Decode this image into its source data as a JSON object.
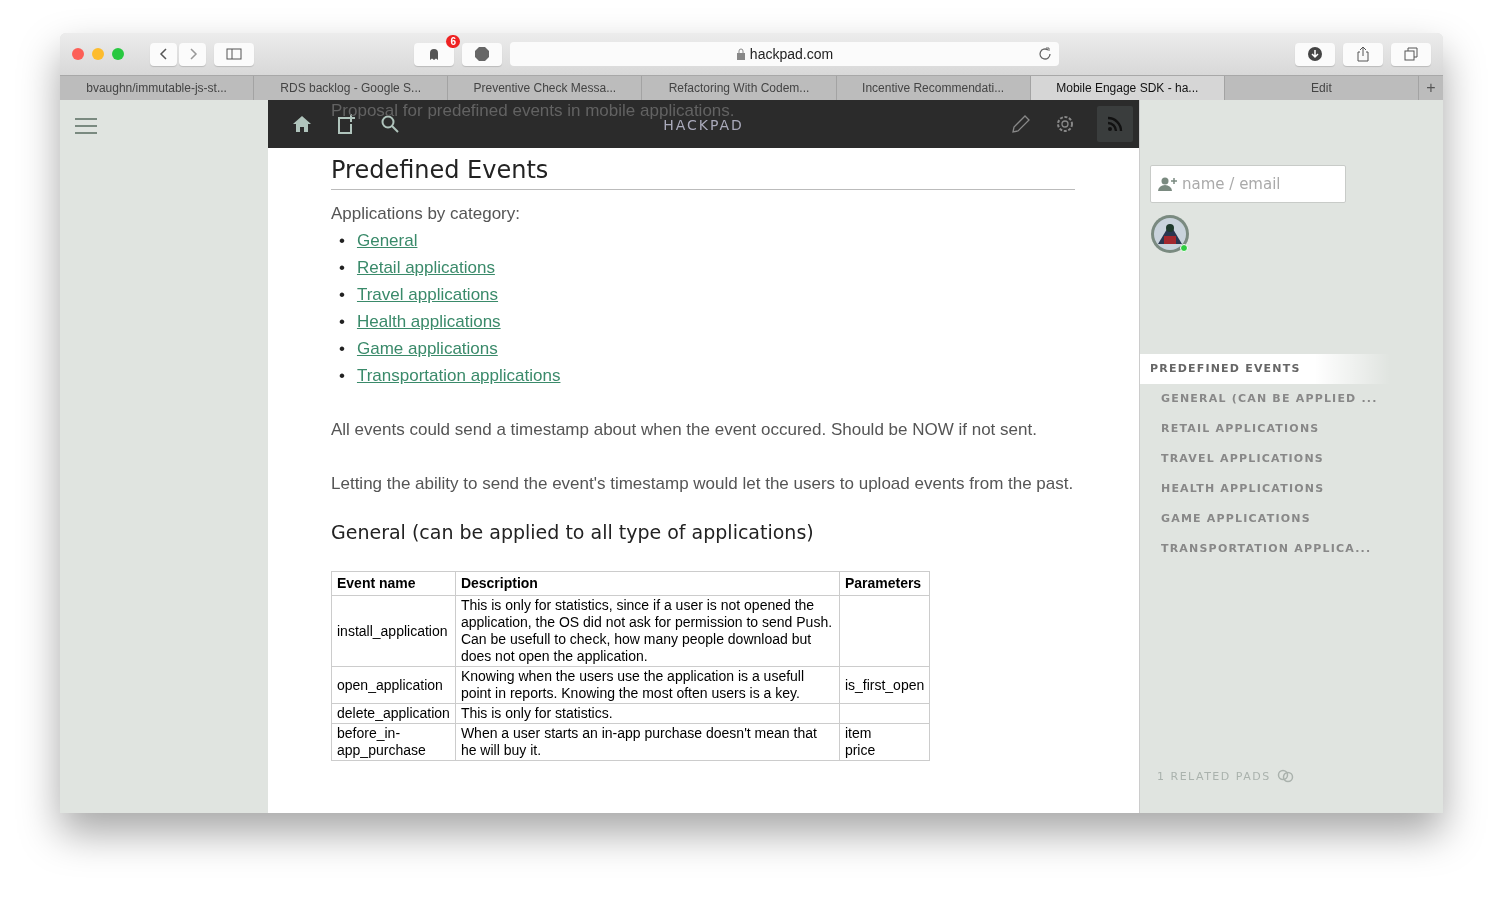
{
  "browser": {
    "address": "hackpad.com",
    "badge": "6",
    "tabs": [
      {
        "label": "bvaughn/immutable-js-st...",
        "selected": false
      },
      {
        "label": "RDS backlog - Google S...",
        "selected": false
      },
      {
        "label": "Preventive Check Messa...",
        "selected": false
      },
      {
        "label": "Refactoring With Codem...",
        "selected": false
      },
      {
        "label": "Incentive Recommendati...",
        "selected": false
      },
      {
        "label": "Mobile Engage SDK - ha...",
        "selected": true
      },
      {
        "label": "Edit",
        "selected": false
      }
    ],
    "new_tab": "+"
  },
  "header": {
    "brand": "HACKPAD",
    "ghost_title": "Proposal for predefined events in mobile applications."
  },
  "document": {
    "title": "Predefined Events",
    "intro": "Applications by category:",
    "links": [
      {
        "bullet": "•",
        "label": "General"
      },
      {
        "bullet": "•",
        "label": "Retail applications"
      },
      {
        "bullet": "•",
        "label": "Travel applications"
      },
      {
        "bullet": "•",
        "label": "Health applications"
      },
      {
        "bullet": "•",
        "label": "Game applications"
      },
      {
        "bullet": "•",
        "label": "Transportation applications"
      }
    ],
    "paragraphs": [
      "All events could send a timestamp about when the event occured. Should be NOW if not sent.",
      "Letting the ability to send the event's timestamp would let the users to upload events from the past."
    ],
    "section_title": "General (can be applied to all type of applications)",
    "table": {
      "columns": [
        "Event name",
        "Description",
        "Parameters"
      ],
      "rows": [
        [
          "install_application",
          "This is only for statistics, since if a user is not opened the application, the OS did not ask for permission to send Push. Can be usefull to check, how many people download but does not open the application.",
          ""
        ],
        [
          "open_application",
          "Knowing when the users use the application is a usefull point in reports. Knowing the most often users is a key.",
          "is_first_open"
        ],
        [
          "delete_application",
          "This is only for statistics.",
          ""
        ],
        [
          "before_in-app_purchase",
          "When a user starts an in-app purchase doesn't mean that he will buy it.",
          "item\nprice"
        ]
      ]
    }
  },
  "sidebar": {
    "invite": {
      "placeholder": "name / email"
    },
    "user": {
      "online": true
    },
    "toc": [
      {
        "label": "PREDEFINED EVENTS",
        "selected": true,
        "children": [
          {
            "label": "GENERAL (CAN BE APPLIED ...",
            "selected": false
          },
          {
            "label": "RETAIL APPLICATIONS",
            "selected": false
          },
          {
            "label": "TRAVEL APPLICATIONS",
            "selected": false
          },
          {
            "label": "HEALTH APPLICATIONS",
            "selected": false
          },
          {
            "label": "GAME APPLICATIONS",
            "selected": false
          },
          {
            "label": "TRANSPORTATION APPLICA...",
            "selected": false
          }
        ]
      }
    ],
    "related": "1 RELATED PADS"
  }
}
